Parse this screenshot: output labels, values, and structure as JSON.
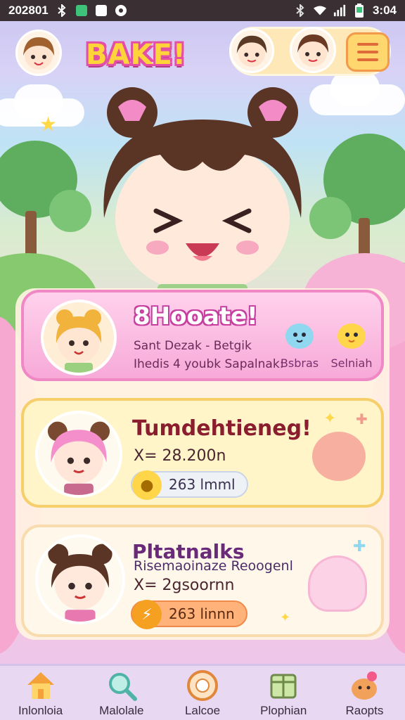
{
  "status_bar": {
    "left_text": "202801",
    "time": "3:04",
    "icons": [
      "bluetooth-icon",
      "shield-icon",
      "app-icon",
      "record-icon",
      "bluetooth-icon",
      "wifi-icon",
      "signal-icon",
      "battery-icon"
    ]
  },
  "header": {
    "logo_text": "BAKE!",
    "menu_icon": "hamburger-icon"
  },
  "cards": [
    {
      "title": "8Hooate!",
      "line1": "Sant Dezak - Betgik",
      "line2": "Ihedis 4 youbk Sapalnak:",
      "pets": [
        {
          "label": "Bsbras",
          "color": "#8fd8f0"
        },
        {
          "label": "Selniah",
          "color": "#ffd54a"
        }
      ]
    },
    {
      "title": "Tumdehtieneg!",
      "stat": "X= 28.200n",
      "pill_value": "263 lmml"
    },
    {
      "title": "Pltatnalks",
      "subtitle": "Risemaoinaze Reoogenl",
      "stat": "X= 2gsoornn",
      "pill_value": "263 linnn"
    }
  ],
  "nav": [
    {
      "label": "Inlonloia",
      "icon": "home-icon"
    },
    {
      "label": "Malolale",
      "icon": "magnifier-icon"
    },
    {
      "label": "Lalcoe",
      "icon": "compass-icon"
    },
    {
      "label": "Plophian",
      "icon": "box-icon"
    },
    {
      "label": "Raopts",
      "icon": "pet-icon"
    }
  ],
  "colors": {
    "accent_pink": "#f088c6",
    "accent_yellow": "#f6cf6a",
    "nav_background": "#e8d8f2"
  }
}
